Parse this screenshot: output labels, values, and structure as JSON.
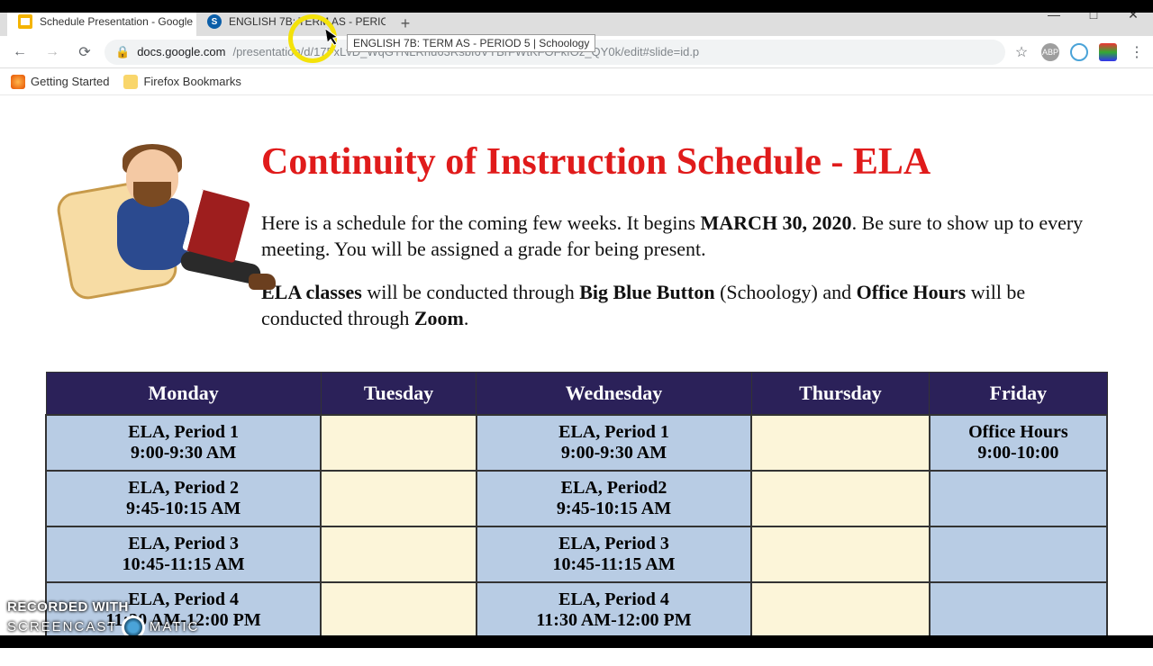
{
  "window": {
    "minimize": "—",
    "maximize": "□",
    "close": "✕"
  },
  "tabs": {
    "active": "Schedule Presentation - Google",
    "second": "ENGLISH 7B: TERM AS - PERIOD",
    "tooltip": "ENGLISH 7B: TERM AS - PERIOD 5 | Schoology"
  },
  "url": {
    "host": "docs.google.com",
    "path": "/presentation/d/17FxLvD_WqGTNLRnu63RsbI6VYBrFWtKFOFkfOz_QY0k/edit#slide=id.p"
  },
  "bookmarks": {
    "item1": "Getting Started",
    "item2": "Firefox Bookmarks"
  },
  "page": {
    "title": "Continuity of Instruction Schedule - ELA",
    "p1a": "Here is a schedule for the coming few weeks.  It begins ",
    "p1b": "MARCH 30, 2020",
    "p1c": ".  Be sure to show up to every meeting.  You will be assigned a grade for being present.",
    "p2a": "ELA classes",
    "p2b": " will be conducted through ",
    "p2c": "Big Blue Button",
    "p2d": " (Schoology) and ",
    "p2e": "Office Hours",
    "p2f": " will be conducted through ",
    "p2g": "Zoom",
    "p2h": "."
  },
  "schedule": {
    "headers": {
      "mon": "Monday",
      "tue": "Tuesday",
      "wed": "Wednesday",
      "thu": "Thursday",
      "fri": "Friday"
    },
    "rows": [
      {
        "mon_t": "ELA, Period 1",
        "mon_s": "9:00-9:30 AM",
        "wed_t": "ELA, Period 1",
        "wed_s": "9:00-9:30 AM",
        "fri_t": "Office Hours",
        "fri_s": "9:00-10:00"
      },
      {
        "mon_t": "ELA, Period 2",
        "mon_s": "9:45-10:15 AM",
        "wed_t": "ELA, Period2",
        "wed_s": "9:45-10:15 AM"
      },
      {
        "mon_t": "ELA, Period 3",
        "mon_s": "10:45-11:15 AM",
        "wed_t": "ELA, Period 3",
        "wed_s": "10:45-11:15 AM"
      },
      {
        "mon_t": "ELA, Period 4",
        "mon_s": "11:30 AM-12:00 PM",
        "wed_t": "ELA, Period 4",
        "wed_s": "11:30 AM-12:00 PM"
      }
    ]
  },
  "watermark": {
    "line1": "RECORDED WITH",
    "line2a": "SCREENCAST",
    "line2b": "MATIC"
  }
}
